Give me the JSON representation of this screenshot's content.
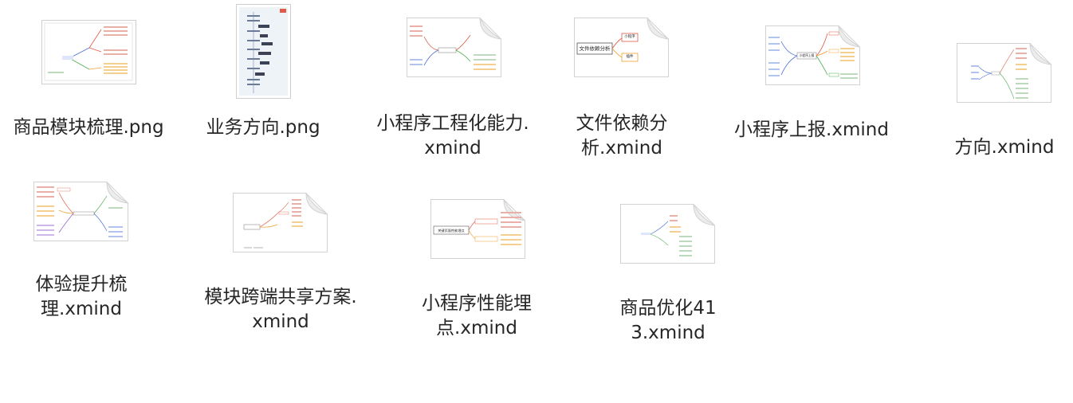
{
  "files": [
    {
      "name": "商品模块梳理.png",
      "kind": "png-map"
    },
    {
      "name": "业务方向.png",
      "kind": "png-tall"
    },
    {
      "name": "小程序工程化能力.xmind",
      "kind": "xmind"
    },
    {
      "name": "文件依赖分析.xmind",
      "kind": "xmind",
      "center_text": "文件依赖分析",
      "branches": [
        "小程序",
        "插件"
      ]
    },
    {
      "name": "小程序上报.xmind",
      "kind": "xmind",
      "center_text": "小程序上报"
    },
    {
      "name": "方向.xmind",
      "kind": "xmind"
    },
    {
      "name": "体验提升梳理.xmind",
      "kind": "xmind"
    },
    {
      "name": "模块跨端共享方案.xmind",
      "kind": "xmind"
    },
    {
      "name": "小程序性能埋点.xmind",
      "kind": "xmind",
      "center_text": "关键页面性能埋点"
    },
    {
      "name": "商品优化413.xmind",
      "kind": "xmind"
    }
  ],
  "colors": {
    "label": "#262626",
    "branch_red": "#e05a47",
    "branch_orange": "#f0a030",
    "branch_green": "#4caf50",
    "branch_blue": "#4a6fd8",
    "branch_purple": "#8e5bc9"
  }
}
